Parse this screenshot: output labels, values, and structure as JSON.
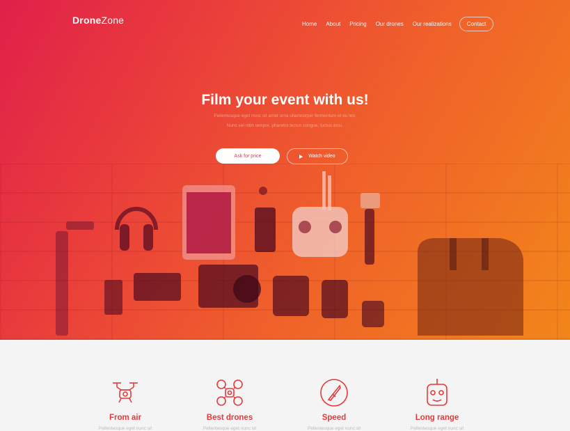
{
  "brand": {
    "bold": "Drone",
    "light": "Zone"
  },
  "nav": {
    "items": [
      "Home",
      "About",
      "Pricing",
      "Our drones",
      "Our realizations"
    ],
    "contact": "Contact"
  },
  "hero": {
    "title": "Film your event with us!",
    "subtitle_1": "Pellentesque eget nunc sit amet urna ullamcorper fermentum et eu leo.",
    "subtitle_2": "Nunc vel nibh tempor, pharetra lectus congue, luctus arcu.",
    "primary_button": "Ask for price",
    "video_button": "Watch video"
  },
  "features": [
    {
      "title": "From air",
      "desc": "Pellentesque eget nunc sit",
      "icon": "drone-icon"
    },
    {
      "title": "Best drones",
      "desc": "Pellentesque eget nunc sit",
      "icon": "quadcopter-icon"
    },
    {
      "title": "Speed",
      "desc": "Pellentesque eget nunc sit",
      "icon": "speed-icon"
    },
    {
      "title": "Long range",
      "desc": "Pellentesque eget nunc sit",
      "icon": "remote-control-icon"
    }
  ],
  "colors": {
    "accent": "#e8383a",
    "gradient_start": "#e0204a",
    "gradient_end": "#f2861a"
  }
}
